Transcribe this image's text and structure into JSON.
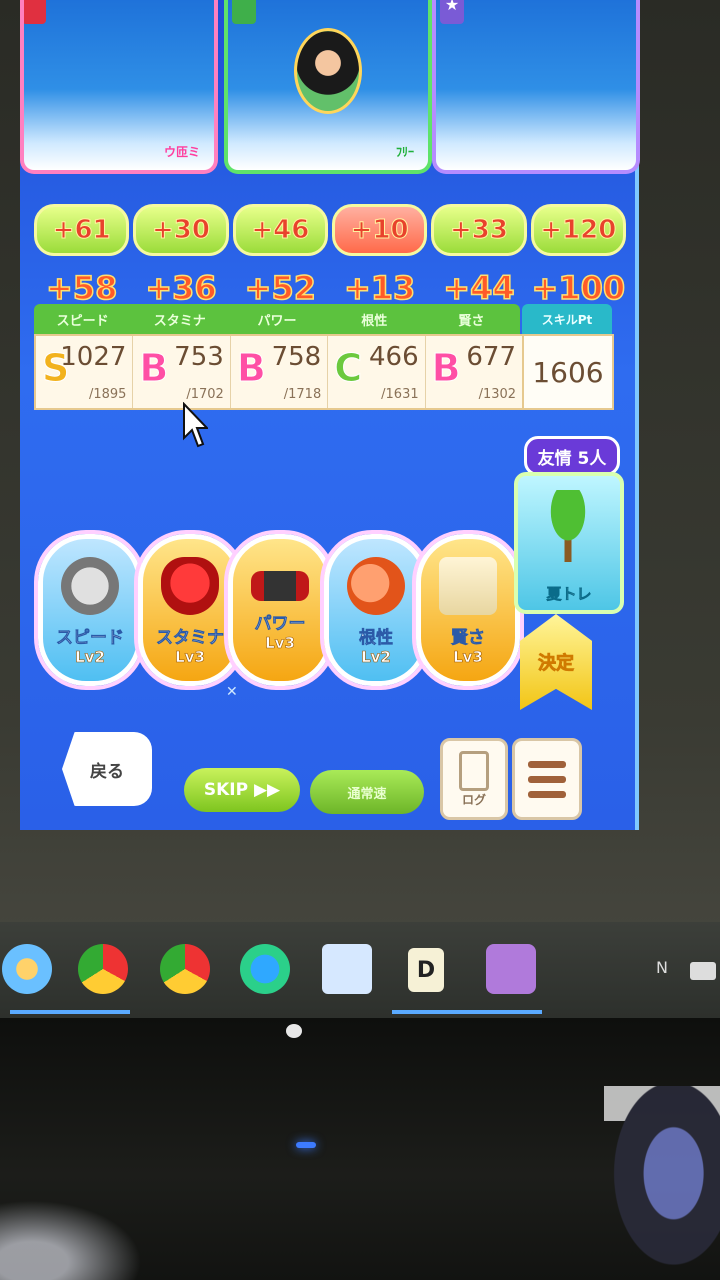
{
  "support_cards": [
    {
      "tag": "ウ匝ミ"
    },
    {
      "tag": "ﾌﾘｰ"
    },
    {
      "tag": ""
    }
  ],
  "bonus_row_1": [
    "+61",
    "+30",
    "+46",
    "+10",
    "+33",
    "+120"
  ],
  "bonus_row_2": [
    "+58",
    "+36",
    "+52",
    "+13",
    "+44",
    "+100"
  ],
  "stat_headers": [
    "スピード",
    "スタミナ",
    "パワー",
    "根性",
    "賢さ"
  ],
  "skill_header": "スキルPt",
  "stats": [
    {
      "grade": "S",
      "value": "1027",
      "max": "/1895"
    },
    {
      "grade": "B",
      "value": "753",
      "max": "/1702"
    },
    {
      "grade": "B",
      "value": "758",
      "max": "/1718"
    },
    {
      "grade": "C",
      "value": "466",
      "max": "/1631"
    },
    {
      "grade": "B",
      "value": "677",
      "max": "/1302"
    }
  ],
  "skill_points": "1606",
  "trainings": [
    {
      "name": "スピード",
      "level": "Lv2"
    },
    {
      "name": "スタミナ",
      "level": "Lv3"
    },
    {
      "name": "パワー",
      "level": "Lv3"
    },
    {
      "name": "根性",
      "level": "Lv2"
    },
    {
      "name": "賢さ",
      "level": "Lv3"
    }
  ],
  "friend_badge": "友情 5人",
  "summer_label": "夏トレ",
  "confirm_label": "決定",
  "back_label": "戻る",
  "skip_label": "SKIP ▶▶",
  "speed_toggle_label": "通常速",
  "log_label": "ログ",
  "taskbar": {
    "d_label": "D",
    "lang": "N"
  },
  "colors": {
    "screen_blue": "#2f6cf0",
    "bonus_text": "#e8422c",
    "stat_header_green": "#5cc23e"
  }
}
